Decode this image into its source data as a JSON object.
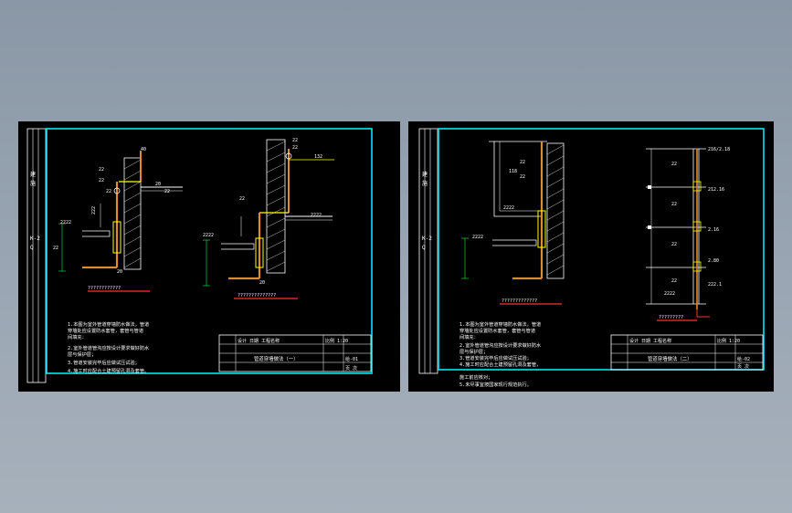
{
  "left": {
    "side_labels": [
      "建",
      "施",
      "K-2",
      "Q"
    ],
    "dims": {
      "d1": "22",
      "d2": "22",
      "d3": "22",
      "d4": "40",
      "d5": "20",
      "d6": "20",
      "d7": "222",
      "d8": "22",
      "d9": "22",
      "d10": "2222",
      "d11": "2222",
      "d12": "132",
      "d13": "2222",
      "d14": "22",
      "d15": "22",
      "d16": "22"
    },
    "caption1": "????????????",
    "caption2": "??????????????",
    "notes": [
      "1.本图为室外管道穿墙防水做法，管道",
      "  穿墙处应设置防水套管，套管与管道",
      "  间填充：",
      "2.室外管道管沟应按设计要求做好防水",
      "  层与保护层；",
      "3.管道安装完毕后应做试压试验；",
      "4.施工时应配合土建预留孔洞及套管。"
    ],
    "title_block": {
      "company": "设计 日期 工程名称",
      "drawing_title": "管道穿墙做法（一）",
      "number": "给-01",
      "scale": "比例 1:20",
      "sheet": "页 次"
    }
  },
  "right": {
    "side_labels": [
      "建",
      "施",
      "K-2",
      "Q"
    ],
    "dims": {
      "r1": "118",
      "r2": "22",
      "r3": "22",
      "r4": "2222",
      "r5": "2222",
      "r6": "2222",
      "r7": "22",
      "r8": "22",
      "r9": "22",
      "r10": "22",
      "r11": "2222",
      "r12": "216/2.18",
      "r13": "212.16",
      "r14": "2.16",
      "r15": "2.80",
      "r16": "222.1"
    },
    "caption1": "?????????????",
    "caption2": "?????????",
    "notes": [
      "1.本图为室外管道穿墙防水做法，管道",
      "  穿墙处应设置防水套管，套管与管道",
      "  间填充：",
      "2.室外管道管沟应按设计要求做好防水",
      "  层与保护层；",
      "3.管道安装完毕后应做试压试验；",
      "4.施工时应配合土建预留孔洞及套管，",
      "  施工前应核对；",
      "5.未尽事宜按国家现行规范执行。"
    ],
    "title_block": {
      "company": "设计 日期 工程名称",
      "drawing_title": "管道穿墙做法（二）",
      "number": "给-02",
      "scale": "比例 1:20",
      "sheet": "页 次"
    }
  },
  "colors": {
    "frame": "#00e5ff",
    "white": "#ffffff",
    "yellow": "#ffff00",
    "orange": "#e08a2c",
    "red": "#ff3030",
    "green": "#00ff40",
    "gray": "#9a9a9a"
  }
}
